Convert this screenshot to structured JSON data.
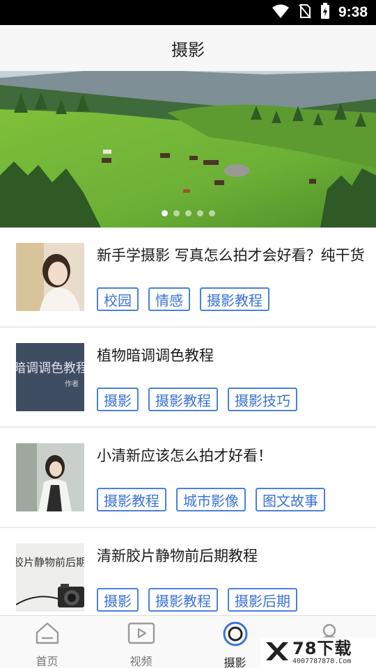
{
  "status_bar": {
    "time": "9:38"
  },
  "header": {
    "title": "摄影"
  },
  "banner": {
    "dot_count": 5,
    "active_index": 0
  },
  "articles": [
    {
      "title": "新手学摄影 写真怎么拍才会好看？纯干货",
      "thumb_text": "",
      "tags": [
        "校园",
        "情感",
        "摄影教程"
      ]
    },
    {
      "title": "植物暗调调色教程",
      "thumb_text": "暗调调色教程",
      "thumb_sub": "作者",
      "tags": [
        "摄影",
        "摄影教程",
        "摄影技巧"
      ]
    },
    {
      "title": "小清新应该怎么拍才好看！",
      "thumb_text": "",
      "tags": [
        "摄影教程",
        "城市影像",
        "图文故事"
      ]
    },
    {
      "title": "清新胶片静物前后期教程",
      "thumb_text": "胶片静物前后期",
      "tags": [
        "摄影",
        "摄影教程",
        "摄影后期"
      ]
    }
  ],
  "tab_bar": {
    "active": 2,
    "tabs": [
      {
        "label": "首页",
        "icon": "home-icon"
      },
      {
        "label": "视频",
        "icon": "video-icon"
      },
      {
        "label": "摄影",
        "icon": "camera-ring-icon"
      },
      {
        "label": "",
        "icon": "profile-icon"
      }
    ]
  },
  "watermark": {
    "brand": "78下载",
    "phone": "4007787878.Com"
  },
  "colors": {
    "accent": "#3a72d8",
    "tag_border": "#4a80e0",
    "status_bar": "#000000"
  }
}
